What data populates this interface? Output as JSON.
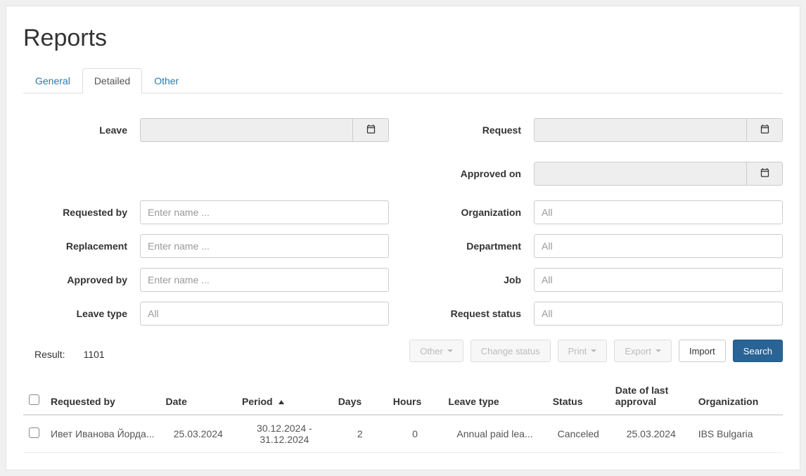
{
  "page": {
    "title": "Reports"
  },
  "tabs": {
    "general": "General",
    "detailed": "Detailed",
    "other": "Other",
    "active": "detailed"
  },
  "filters": {
    "leave_label": "Leave",
    "request_label": "Request",
    "approved_on_label": "Approved on",
    "requested_by_label": "Requested by",
    "requested_by_placeholder": "Enter name ...",
    "replacement_label": "Replacement",
    "replacement_placeholder": "Enter name ...",
    "approved_by_label": "Approved by",
    "approved_by_placeholder": "Enter name ...",
    "leave_type_label": "Leave type",
    "leave_type_value": "All",
    "organization_label": "Organization",
    "organization_value": "All",
    "department_label": "Department",
    "department_value": "All",
    "job_label": "Job",
    "job_value": "All",
    "request_status_label": "Request status",
    "request_status_value": "All"
  },
  "result": {
    "label": "Result:",
    "count": "1101"
  },
  "actions": {
    "other": "Other",
    "change_status": "Change status",
    "print": "Print",
    "export": "Export",
    "import": "Import",
    "search": "Search"
  },
  "table": {
    "headers": {
      "requested_by": "Requested by",
      "date": "Date",
      "period": "Period",
      "days": "Days",
      "hours": "Hours",
      "leave_type": "Leave type",
      "status": "Status",
      "date_of_last_approval": "Date of last approval",
      "organization": "Organization"
    },
    "rows": [
      {
        "requested_by": "Ивет Иванова Йорда...",
        "date": "25.03.2024",
        "period": "30.12.2024 - 31.12.2024",
        "days": "2",
        "hours": "0",
        "leave_type": "Annual paid lea...",
        "status": "Canceled",
        "date_of_last_approval": "25.03.2024",
        "organization": "IBS Bulgaria"
      }
    ]
  }
}
